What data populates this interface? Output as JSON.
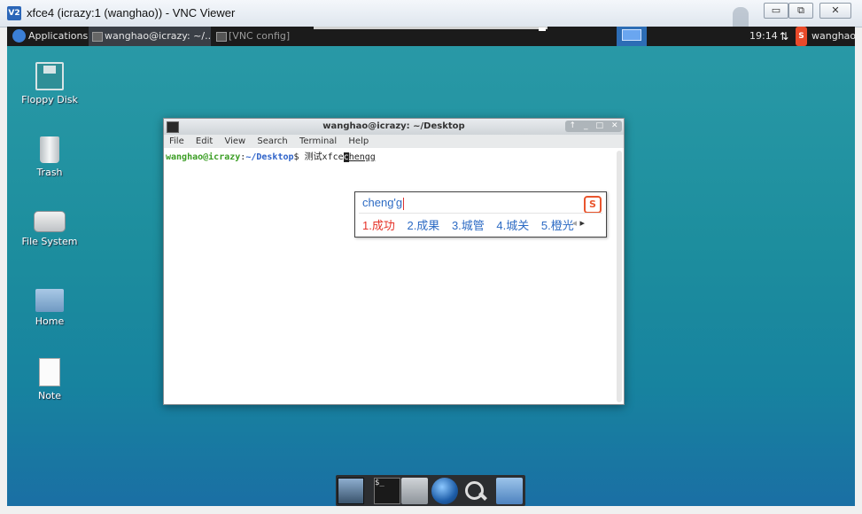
{
  "window": {
    "title": "xfce4 (icrazy:1 (wanghao)) - VNC Viewer",
    "icon": "vnc-icon",
    "controls": [
      "minimize",
      "restore",
      "close"
    ]
  },
  "panel": {
    "applications_label": "Applications",
    "tasks": [
      {
        "label": "wanghao@icrazy: ~/...",
        "active": true
      },
      {
        "label": "[VNC config]",
        "active": false
      }
    ],
    "clock": "19:14",
    "user": "wanghao"
  },
  "desktop_icons": [
    {
      "label": "Floppy Disk",
      "icon": "floppy-icon"
    },
    {
      "label": "Trash",
      "icon": "trash-icon"
    },
    {
      "label": "File System",
      "icon": "drive-icon"
    },
    {
      "label": "Home",
      "icon": "home-folder-icon"
    },
    {
      "label": "Note",
      "icon": "note-icon"
    }
  ],
  "terminal": {
    "title": "wanghao@icrazy: ~/Desktop",
    "menu": [
      "File",
      "Edit",
      "View",
      "Search",
      "Terminal",
      "Help"
    ],
    "prompt_user": "wanghao@icrazy",
    "prompt_sep": ":",
    "prompt_path": "~/Desktop",
    "prompt_symbol": "$ ",
    "typed": "测试xfce",
    "cursor_char": "c",
    "preedit": "hengg"
  },
  "ime": {
    "input": "cheng'g",
    "logo": "S",
    "candidates": [
      "1.成功",
      "2.成果",
      "3.城管",
      "4.城关",
      "5.橙光"
    ],
    "selected_index": 0
  },
  "dock": {
    "items": [
      "show-desktop-icon",
      "terminal-icon",
      "home-folder-icon",
      "web-browser-icon",
      "search-icon",
      "file-manager-icon"
    ]
  }
}
